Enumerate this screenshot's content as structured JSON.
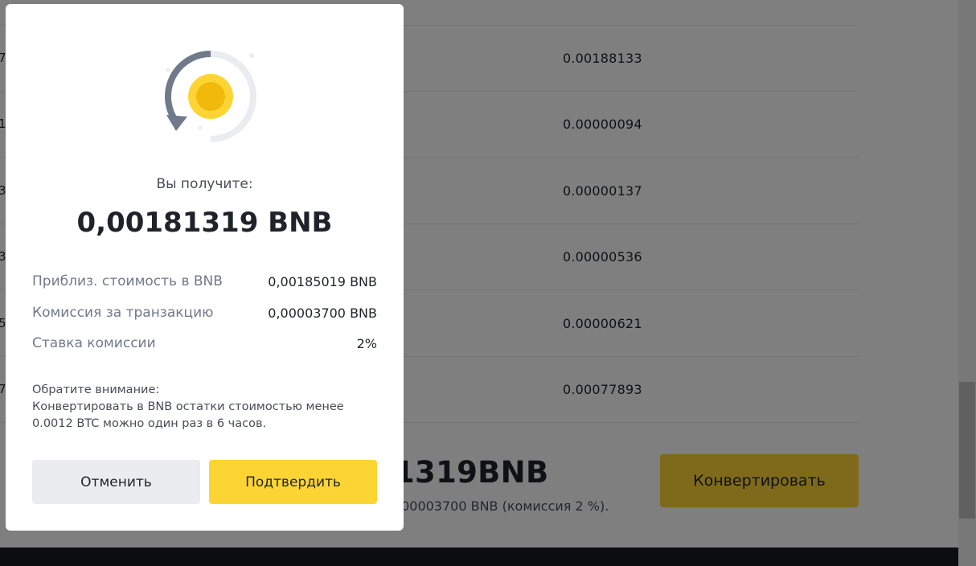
{
  "background": {
    "rows": [
      {
        "left_num": "7",
        "value": "0.00188133"
      },
      {
        "left_num": "1",
        "value": "0.00000094"
      },
      {
        "left_num": "3",
        "value": "0.00000137"
      },
      {
        "left_num": "3",
        "value": "0.00000536"
      },
      {
        "left_num": "5",
        "value": "0.00000621"
      },
      {
        "left_num": "7",
        "value": "0.00077893"
      }
    ],
    "summary_amount": "1319BNB",
    "summary_fee": ",00003700 BNB (комиссия 2 %).",
    "convert_button": "Конвертировать"
  },
  "modal": {
    "receive_label": "Вы получите:",
    "receive_amount": "0,00181319 BNB",
    "details": [
      {
        "label": "Приблиз. стоимость в BNB",
        "value": "0,00185019 BNB"
      },
      {
        "label": "Комиссия за транзакцию",
        "value": "0,00003700 BNB"
      },
      {
        "label": "Ставка комиссии",
        "value": "2%"
      }
    ],
    "note_title": "Обратите внимание:",
    "note_text": "Конвертировать в BNB остатки стоимостью менее 0.0012 BTC можно один раз в 6 часов.",
    "cancel_label": "Отменить",
    "confirm_label": "Подтвердить"
  },
  "colors": {
    "accent": "#fcd535",
    "overlay": "rgba(0,0,0,0.5)"
  }
}
